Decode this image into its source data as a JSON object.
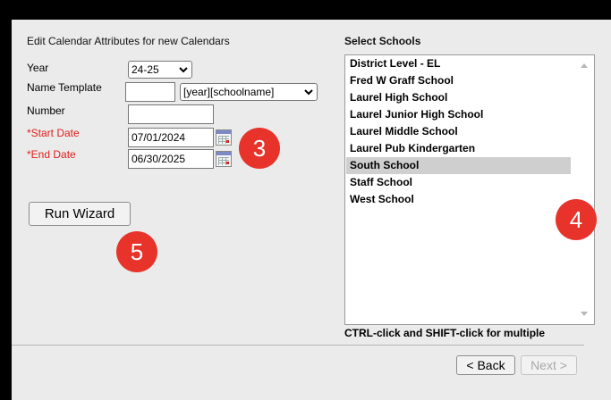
{
  "left_title": "Edit Calendar Attributes for new Calendars",
  "right_title": "Select Schools",
  "fields": {
    "year_label": "Year",
    "year_value": "24-25",
    "name_template_label": "Name Template",
    "name_template_value": "",
    "name_template_option": "[year][schoolname]",
    "number_label": "Number",
    "number_value": "",
    "start_date_label": "*Start Date",
    "start_date_value": "07/01/2024",
    "end_date_label": "*End Date",
    "end_date_value": "06/30/2025"
  },
  "run_wizard": "Run Wizard",
  "schools": [
    "District Level - EL",
    "Fred W Graff School",
    "Laurel High School",
    "Laurel Junior High School",
    "Laurel Middle School",
    "Laurel Pub Kindergarten",
    "South School",
    "Staff School",
    "West School"
  ],
  "selected_school": "South School",
  "hint": "CTRL-click and SHIFT-click for multiple",
  "nav": {
    "back": "< Back",
    "next": "Next >"
  },
  "badges": {
    "dates": "3",
    "schools": "4",
    "run": "5"
  },
  "colors": {
    "required": "#e0201c",
    "badge": "#e7332a",
    "selected_row": "#cfcfcf"
  }
}
